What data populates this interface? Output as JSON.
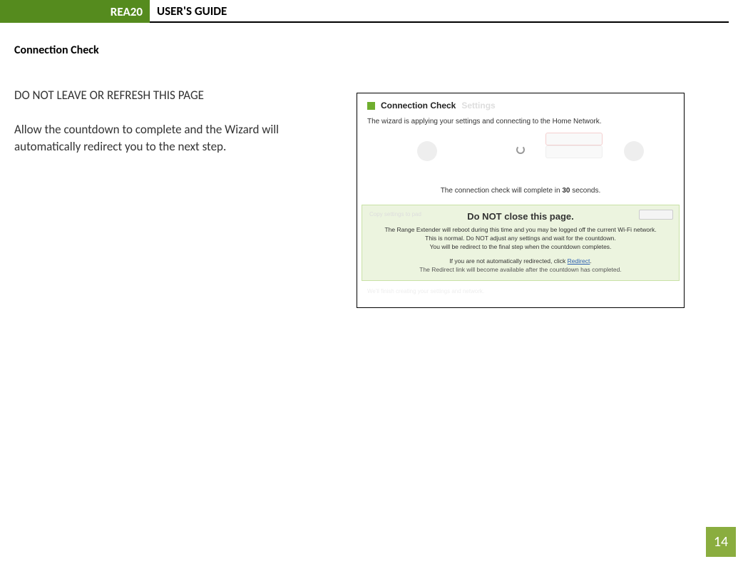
{
  "header": {
    "product": "REA20",
    "title": "USER'S GUIDE"
  },
  "section_title": "Connection Check",
  "para1": "DO NOT LEAVE OR REFRESH THIS PAGE",
  "para2": "Allow the countdown to complete and the Wizard will automatically redirect you to the next step.",
  "screenshot": {
    "title": "Connection Check",
    "title_grey": "Settings",
    "subtitle": "The wizard is applying your settings and connecting to the Home Network.",
    "countdown_prefix": "The connection check will complete in ",
    "countdown_seconds": "30",
    "countdown_suffix": " seconds.",
    "panel_title": "Do NOT close this page.",
    "panel_line1": "The Range Extender will reboot during this time and you may be logged off the current Wi-Fi network.",
    "panel_line2": "This is normal. Do NOT adjust any settings and wait for the countdown.",
    "panel_line3": "You will be redirect to the final step when the countdown completes.",
    "redirect_prefix": "If you are not automatically redirected, click ",
    "redirect_link": "Redirect",
    "after_note": "The Redirect link will become available after the countdown has completed."
  },
  "page_number": "14"
}
